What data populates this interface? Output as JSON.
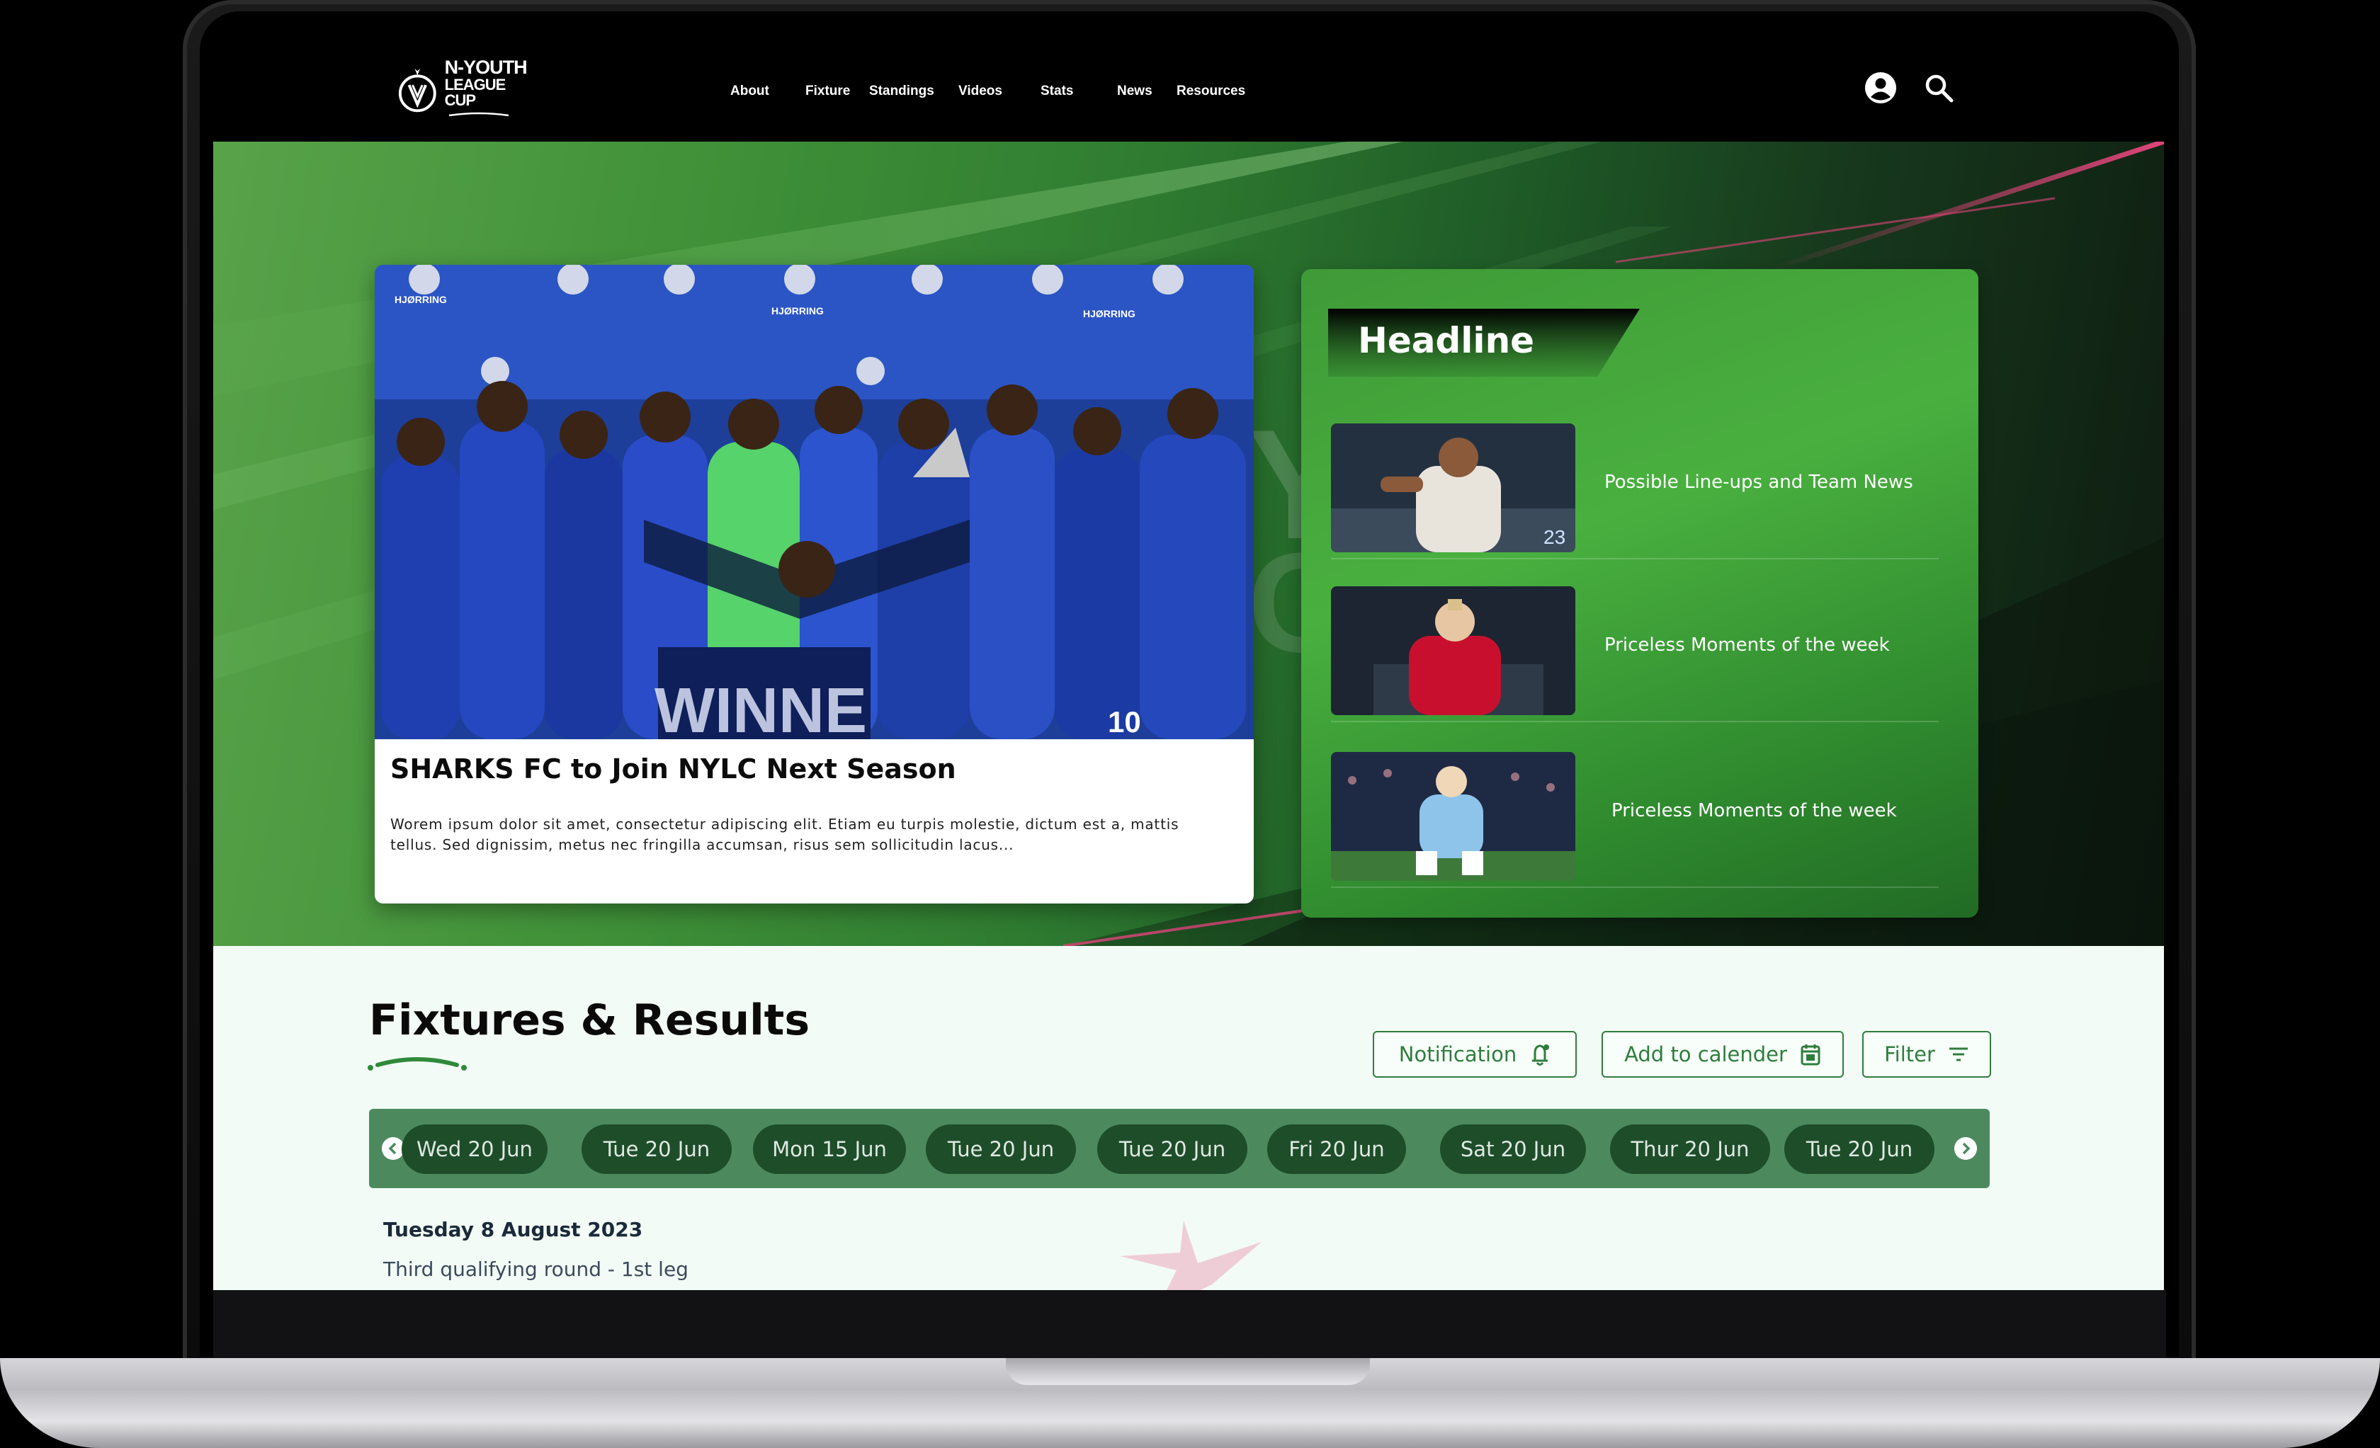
{
  "site": {
    "logo": {
      "line1": "N-YOUTH",
      "line2": "LEAGUE CUP"
    },
    "nav": [
      "About",
      "Fixture",
      "Standings",
      "Videos",
      "Stats",
      "News",
      "Resources"
    ],
    "icons": {
      "account": "user-circle-icon",
      "search": "search-icon"
    }
  },
  "hero": {
    "feature": {
      "title": "SHARKS FC to Join NYLC Next Season",
      "excerpt": "Worem ipsum dolor sit amet, consectetur adipiscing elit. Etiam eu turpis molestie, dictum est a, mattis tellus. Sed dignissim, metus nec fringilla accumsan, risus sem sollicitudin lacus...",
      "photo_banner": "WINNE",
      "photo_sponsor": "HJØRRING",
      "photo_shirt_number": "10"
    },
    "headline": {
      "title": "Headline",
      "items": [
        {
          "text": "Possible Line-ups and Team News",
          "thumb_number": "23"
        },
        {
          "text": "Priceless Moments of the week"
        },
        {
          "text": "Priceless Moments of the week"
        }
      ]
    }
  },
  "fixtures": {
    "title": "Fixtures & Results",
    "buttons": {
      "notification": "Notification",
      "calendar": "Add to calender",
      "filter": "Filter"
    },
    "dates": [
      "Wed 20 Jun",
      "Tue 20 Jun",
      "Mon 15 Jun",
      "Tue 20 Jun",
      "Tue 20 Jun",
      "Fri 20 Jun",
      "Sat 20 Jun",
      "Thur 20 Jun",
      "Tue 20 Jun"
    ],
    "date_heading": "Tuesday 8 August 2023",
    "round": "Third qualifying round - 1st leg"
  },
  "colors": {
    "brand_green": "#2f7d3d",
    "strip_green": "#4c8a5e",
    "pill_dark": "#1e4d2a",
    "accent_pink": "#e0457a"
  }
}
